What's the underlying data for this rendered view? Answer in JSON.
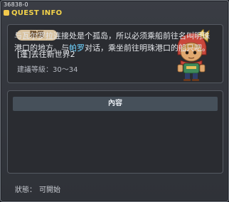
{
  "quest_id": "36838-0",
  "title": "QUEST INFO",
  "job_label": "職業",
  "quest_name": "[蓬]去往新世界2",
  "level_label": "建議等級：",
  "level_range": "30～34",
  "content_header": "內容",
  "description": {
    "part1": "与瓦尔罗拉连接处是个孤岛，所以必须乘船前往名叫明珠港口的地方。与",
    "npc_name": "帕罗",
    "part2": "对话，乘坐前往明珠港口的船只吧。"
  },
  "status_label": "狀態：",
  "status_value": "可開始",
  "colors": {
    "title": "#f3d34a",
    "npc_highlight": "#6fd3ff",
    "job_tag_bg": "#d9c3a0"
  }
}
